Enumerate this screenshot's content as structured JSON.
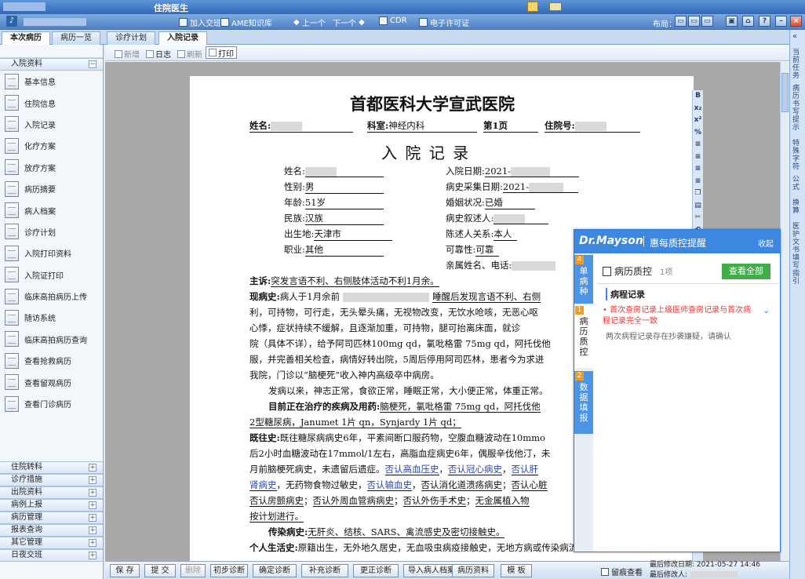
{
  "window": {
    "title": "住院医生"
  },
  "toolbar": {
    "items": [
      "加入交班",
      "AME知识库",
      "上一个",
      "下一个",
      "CDR",
      "电子许可证"
    ],
    "layout_label": "布局："
  },
  "tabs": {
    "left": [
      {
        "label": "本次病历"
      },
      {
        "label": "病历一览"
      }
    ],
    "main": [
      {
        "label": "诊疗计划"
      },
      {
        "label": "入院记录"
      }
    ]
  },
  "sidebar": {
    "top_section": "入院资料",
    "items": [
      "基本信息",
      "住院信息",
      "入院记录",
      "化疗方案",
      "放疗方案",
      "病历摘要",
      "病人档案",
      "诊疗计划",
      "入院打印资料",
      "入院证打印",
      "临床高拍病历上传",
      "随访系统",
      "临床高拍病历查询",
      "查看抢救病历",
      "查看留观病历",
      "查看门诊病历"
    ],
    "bottom_sections": [
      "住院转科",
      "诊疗措施",
      "出院资料",
      "病例上报",
      "病历管理",
      "报表查询",
      "其它管理",
      "日夜交班"
    ]
  },
  "doc_toolbar": {
    "new": "新增",
    "log": "日志",
    "refresh": "刷新",
    "print": "打印"
  },
  "document": {
    "hospital": "首都医科大学宣武医院",
    "hdr": {
      "name_label": "姓名:",
      "dept_label": "科室:",
      "dept": "神经内科",
      "page": "第1页",
      "admit_no_label": "住院号:"
    },
    "title": "入 院 记 录",
    "fields": {
      "name_label": "姓名:",
      "gender_label": "性别:",
      "gender": "男",
      "age_label": "年龄:",
      "age": "51岁",
      "ethnic_label": "民族:",
      "ethnic": "汉族",
      "birth_label": "出生地:",
      "birth": "天津市",
      "job_label": "职业:",
      "job": "其他",
      "admit_date_label": "入院日期:",
      "admit_date": "2021-",
      "hist_date_label": "病史采集日期:",
      "hist_date": "2021-",
      "marital_label": "婚姻状况:",
      "marital": "已婚",
      "narrator_label": "病史叙述人:",
      "relation_label": "陈述人关系:",
      "relation": "本人",
      "reliability_label": "可靠性:",
      "reliability": "可靠",
      "kin_label": "亲属姓名、电话:"
    },
    "complaint_label": "主诉:",
    "complaint": "突发言语不利、右侧肢体活动不利1月余。",
    "hpi_label": "现病史:",
    "hpi_lines": [
      "病人于1月余前",
      "睡醒后发现言语不利、右侧",
      "利，可持物，可行走，无头晕头痛，无视物改变，无饮水呛咳，无恶心呕",
      "心悸，症状持续不缓解，且逐渐加重，可持物，腿可抬离床面，就诊",
      "院（具体不详），给予阿司匹林100mg qd，氯吡格雷 75mg qd，阿托伐他",
      "服，并完善相关检查，病情好转出院，5周后停用阿司匹林，患者今为求进",
      "我院，门诊以“脑梗死”收入神内高级卒中病房。"
    ],
    "since_line": "发病以来，神志正常，食欲正常，睡眠正常，大小便正常，体重正常。",
    "current_label": "目前正在治疗的疾病及用药:",
    "current": "脑梗死，氯吡格雷 75mg qd，阿托伐他",
    "current2": "2型糖尿病，Janumet 1片 qn，Synjardy 1片 qd；",
    "past_label": "既往史:",
    "past_lines": [
      "既往糖尿病病史6年，平素间断口服药物，空腹血糖波动在10mmo",
      "后2小时血糖波动在17mmol/1左右，高脂血症病史6年，偶服辛伐他汀，未",
      "月前脑梗死病史，未遗留后遗症。"
    ],
    "past_links": [
      "否认高血压史",
      "否认冠心病史",
      "否认肝",
      "肾病史"
    ],
    "past_tail": "，无药物食物过敏史，",
    "past_more": [
      "否认输血史",
      "否认消化道溃疡病史",
      "否认心脏"
    ],
    "past_more2": [
      "否认房颤病史",
      "否认外周血管病病史",
      "否认外伤手术史",
      "无金属植入物"
    ],
    "past_end": "按计划进行。",
    "infect_label": "传染病史:",
    "infect": "无肝炎、结核、SARS、禽流感史及密切接触史。",
    "personal_label": "个人生活史:",
    "personal": "原籍出生，无外地久居史，无血吸虫病疫接触史，无地方病或传染病流"
  },
  "mayson": {
    "brand": "Dr.Mayson",
    "subtitle": "惠每质控提醒",
    "collapse": "收起",
    "tabs": [
      {
        "num": "4",
        "label": "单病种"
      },
      {
        "num": "1",
        "label": "病历质控"
      },
      {
        "num": "2",
        "label": "数据填报"
      }
    ],
    "qc_title": "病历质控",
    "qc_count": "1项",
    "view_all": "查看全部",
    "section": "病程记录",
    "alert": "首次查房记录上级医师查房记录与首次病程记录完全一致",
    "alert_desc": "两次病程记录存在抄袭嫌疑，请确认"
  },
  "bottom": {
    "buttons": [
      "保 存",
      "提 交",
      "删除",
      "初步诊断",
      "确定诊断",
      "补充诊断",
      "更正诊断",
      "导入病人档案",
      "病历资料",
      "模 板"
    ],
    "trace": "留痕查看",
    "mod_date_label": "最后修改日期:",
    "mod_date": "2021-05-27 14:46",
    "modifier_label": "最后修改人:"
  },
  "right_rail": [
    "当前任务",
    "病历书写提示",
    "特殊字符",
    "公式",
    "换算",
    "医护文书填写指引"
  ]
}
